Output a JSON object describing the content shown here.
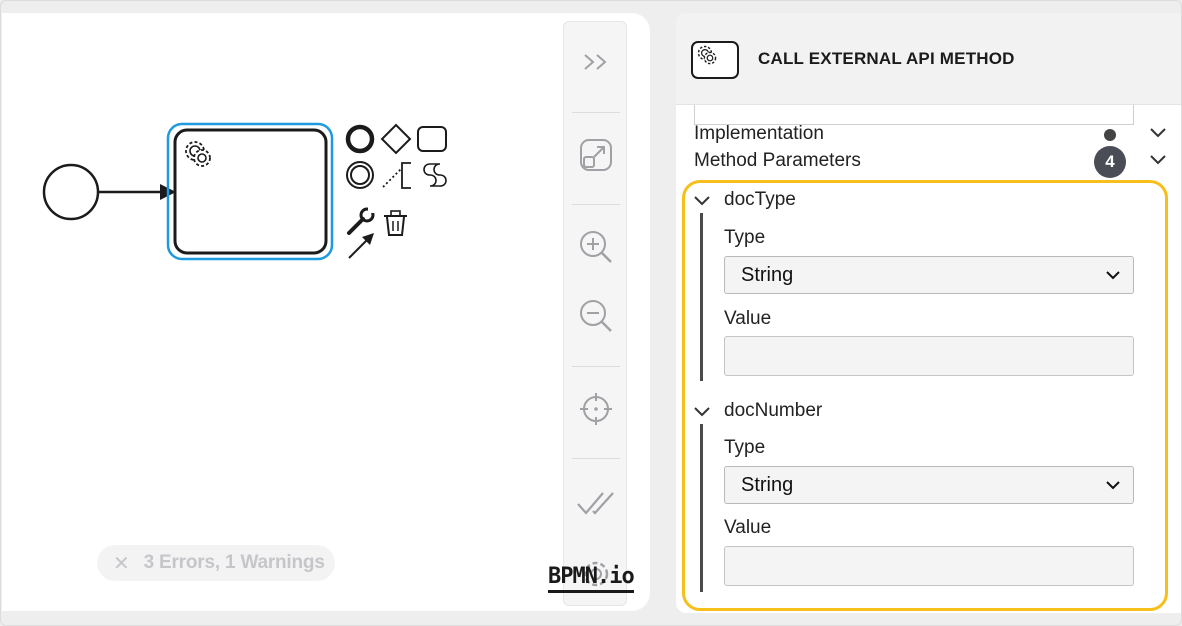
{
  "status": {
    "text": "3 Errors, 1 Warnings"
  },
  "brand": {
    "logo_text": "BPMN.io"
  },
  "panel": {
    "title": "CALL EXTERNAL API METHOD",
    "groups": [
      {
        "label": "Implementation",
        "indicator": "dot"
      },
      {
        "label": "Method Parameters",
        "badge": "4"
      }
    ],
    "parameters": [
      {
        "name": "docType",
        "type_label": "Type",
        "type_value": "String",
        "value_label": "Value",
        "value": ""
      },
      {
        "name": "docNumber",
        "type_label": "Type",
        "type_value": "String",
        "value_label": "Value",
        "value": ""
      }
    ]
  },
  "colors": {
    "selection": "#1e9be0",
    "highlight": "#f6bf1b",
    "badge": "#4a4d55"
  }
}
